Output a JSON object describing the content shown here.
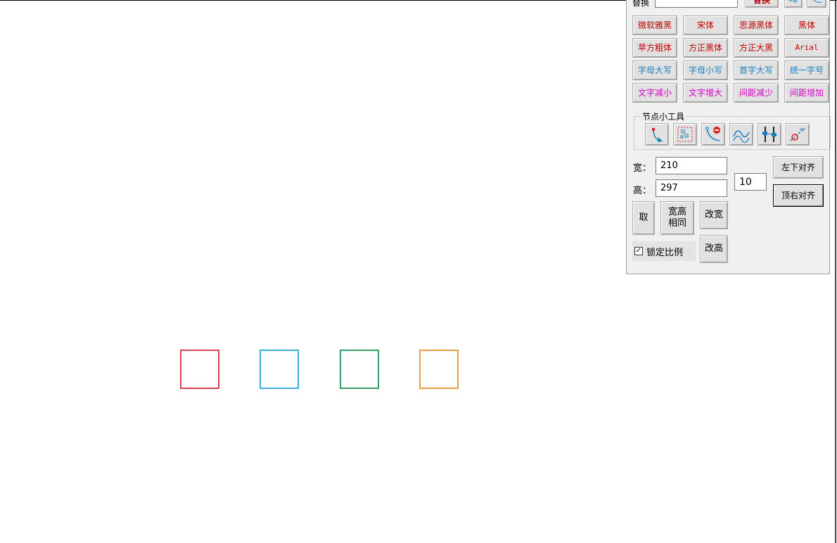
{
  "top_row": {
    "label": "替换",
    "replace_button": "替换"
  },
  "font_buttons": [
    {
      "label": "微软雅黑",
      "color": "#c00000"
    },
    {
      "label": "宋体",
      "color": "#c00000"
    },
    {
      "label": "思源黑体",
      "color": "#c00000"
    },
    {
      "label": "黑体",
      "color": "#c00000"
    },
    {
      "label": "苹方粗体",
      "color": "#c00000"
    },
    {
      "label": "方正黑体",
      "color": "#c00000"
    },
    {
      "label": "方正大黑",
      "color": "#c00000"
    },
    {
      "label": "Arial",
      "color": "#c00000"
    }
  ],
  "case_buttons": [
    {
      "label": "字母大写"
    },
    {
      "label": "字母小写"
    },
    {
      "label": "首字大写"
    },
    {
      "label": "统一字号"
    }
  ],
  "spacing_buttons": [
    {
      "label": "文字减小"
    },
    {
      "label": "文字增大"
    },
    {
      "label": "间距减少"
    },
    {
      "label": "间距增加"
    }
  ],
  "node_tools": {
    "title": "节点小工具",
    "icons": [
      "node-curve-icon",
      "node-select-icon",
      "node-delete-icon",
      "node-smooth-icon",
      "node-align-icon",
      "node-break-icon"
    ]
  },
  "size": {
    "width_label": "宽：",
    "width_value": "210",
    "height_label": "高：",
    "height_value": "297",
    "step_value": "10"
  },
  "align_buttons": {
    "bottom_left": "左下对齐",
    "top_right": "顶右对齐"
  },
  "action_buttons": {
    "take": "取",
    "same_wh": "宽高\n相同",
    "change_width": "改宽",
    "change_height": "改高"
  },
  "lock_ratio": {
    "label": "锁定比例",
    "checked": true
  },
  "canvas_squares": [
    {
      "name": "red",
      "color": "#d9444f"
    },
    {
      "name": "blue",
      "color": "#3ab0d8"
    },
    {
      "name": "green",
      "color": "#3a9a6a"
    },
    {
      "name": "orange",
      "color": "#e8a040"
    }
  ]
}
